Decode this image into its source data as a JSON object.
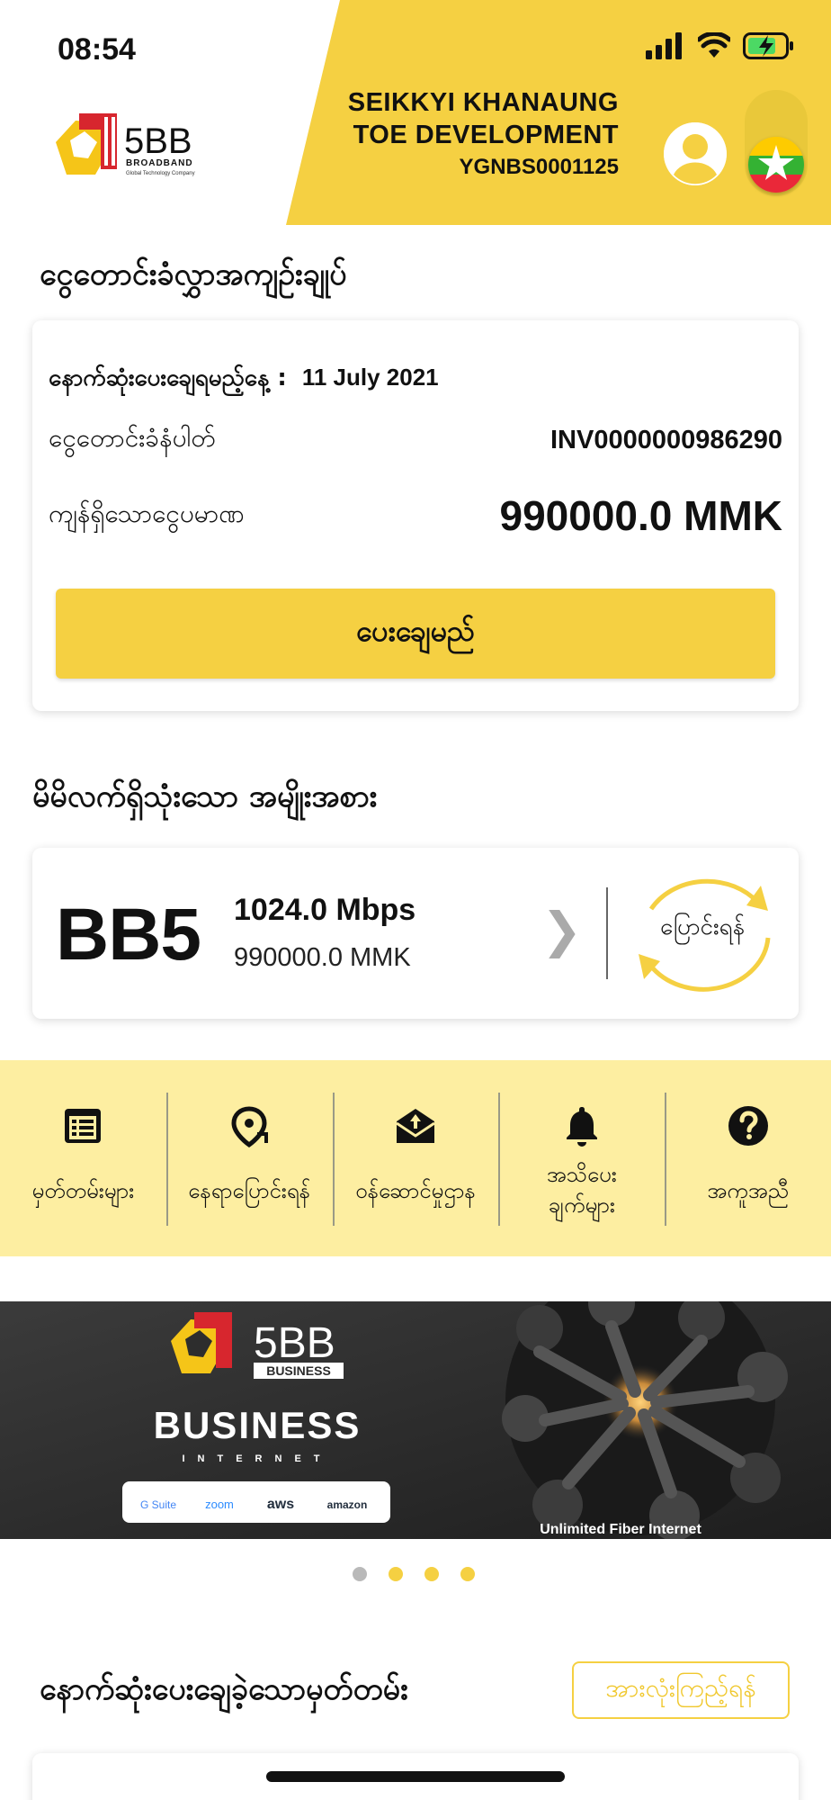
{
  "status_bar": {
    "time": "08:54"
  },
  "header": {
    "brand": {
      "name": "5BB",
      "sub": "BROADBAND",
      "tagline": "Global Technology Company"
    },
    "company_line1": "SEIKKYI KHANAUNG",
    "company_line2": "TOE DEVELOPMENT",
    "account_id": "YGNBS0001125"
  },
  "bill": {
    "section_title": "ငွေတောင်းခံလွှာအကျဉ်းချုပ်",
    "due_label": "နောက်ဆုံးပေးချေရမည့်နေ့ :",
    "due_date": "11 July 2021",
    "invoice_label": "ငွေတောင်းခံနံပါတ်",
    "invoice_no": "INV0000000986290",
    "amount_label": "ကျန်ရှိသောငွေပမာဏ",
    "amount": "990000.0 MMK",
    "pay_button": "ပေးချေမည်"
  },
  "plan": {
    "section_title": "မိမိလက်ရှိသုံးသော အမျိုးအစား",
    "name": "BB5",
    "speed": "1024.0 Mbps",
    "price": "990000.0 MMK",
    "change_label": "ပြောင်းရန်"
  },
  "quick_actions": [
    {
      "icon": "invoice-list-icon",
      "label": "မှတ်တမ်းများ"
    },
    {
      "icon": "relocate-icon",
      "label": "နေရာပြောင်းရန်"
    },
    {
      "icon": "service-center-icon",
      "label": "ဝန်ဆောင်မှုဌာန"
    },
    {
      "icon": "bell-icon",
      "label_line1": "အသိပေး",
      "label_line2": "ချက်များ"
    },
    {
      "icon": "help-icon",
      "label": "အကူအညီ"
    }
  ],
  "banner": {
    "brand": "5BB",
    "brand_sub": "BUSINESS",
    "headline": "BUSINESS",
    "subhead": "INTERNET",
    "partners": [
      "G Suite",
      "zoom",
      "aws",
      "amazon"
    ],
    "caption": "Unlimited Fiber Internet"
  },
  "carousel": {
    "dot_colors": [
      "#b9b9b9",
      "#f5d042",
      "#f5d042",
      "#f5d042"
    ]
  },
  "last_payments": {
    "section_title": "နောက်ဆုံးပေးချေခဲ့သောမှတ်တမ်း",
    "view_all": "အားလုံးကြည့်ရန်"
  },
  "colors": {
    "accent": "#f5d042",
    "accent_light": "#fdeea1",
    "dark": "#111111"
  }
}
